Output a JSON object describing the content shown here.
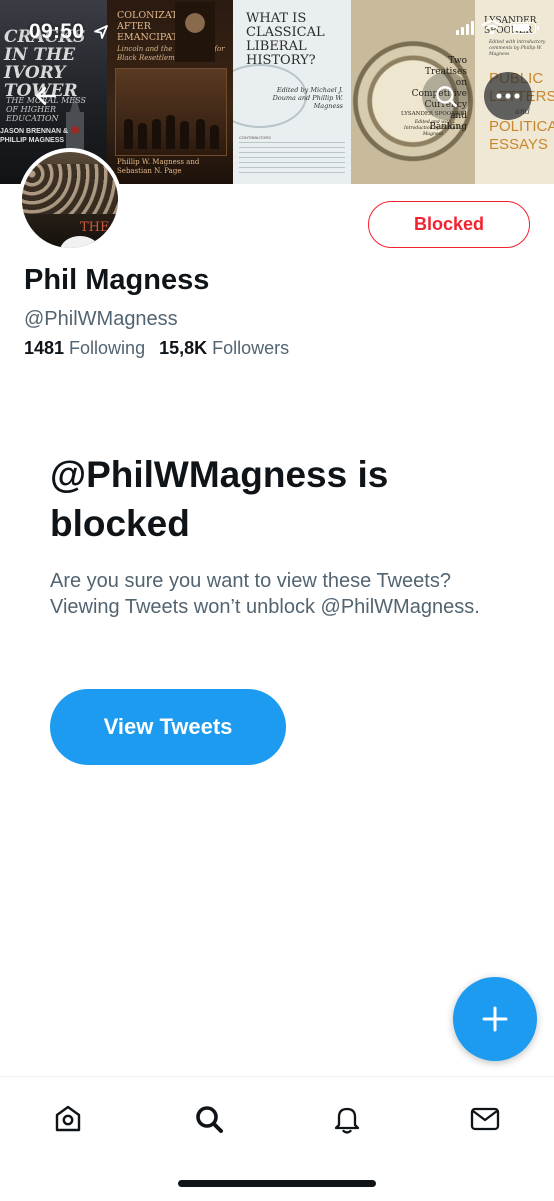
{
  "status_bar": {
    "time": "09:50"
  },
  "banner": {
    "book1": {
      "title": "CRACKS IN THE IVORY TOWER",
      "subtitle": "THE MORAL MESS OF HIGHER EDUCATION",
      "authors": "JASON BRENNAN & PHILLIP MAGNESS"
    },
    "book2": {
      "title": "COLONIZATION AFTER EMANCIPATION",
      "subtitle": "Lincoln and the Movement for Black Resettlement",
      "authors": "Phillip W. Magness and Sebastian N. Page"
    },
    "book3": {
      "title": "WHAT IS CLASSICAL LIBERAL HISTORY?",
      "editors": "Edited by Michael J. Douma and Phillip W. Magness",
      "contributors": "CONTRIBUTORS"
    },
    "book4": {
      "title": "Two Treatises on Competitive Currency and Banking",
      "author": "LYSANDER SPOONER",
      "editor": "Edited and with Introduction by Phillip W. Magness"
    },
    "book5": {
      "author": "LYSANDER SPOONER",
      "note": "Edited with introductory comments by Phillip W. Magness",
      "title_line1": "PUBLIC LETTERS",
      "and": "and",
      "title_line2": "POLITICAL ESSAYS"
    }
  },
  "profile": {
    "avatar_text": "THE",
    "name": "Phil Magness",
    "handle": "@PhilWMagness",
    "following_count": "1481",
    "following_label": "Following",
    "followers_count": "15,8K",
    "followers_label": "Followers",
    "blocked_button": "Blocked"
  },
  "blocked_notice": {
    "title": "@PhilWMagness is blocked",
    "description": "Are you sure you want to view these Tweets? Viewing Tweets won’t unblock @PhilWMagness.",
    "view_button": "View Tweets"
  },
  "colors": {
    "accent": "#1d9bf0",
    "blocked_red": "#f4212e",
    "text_primary": "#0f1419",
    "text_secondary": "#536471"
  },
  "icons": [
    "back-arrow-icon",
    "search-icon",
    "more-icon",
    "compose-plus-icon",
    "home-icon",
    "explore-search-icon",
    "notifications-bell-icon",
    "messages-mail-icon"
  ]
}
